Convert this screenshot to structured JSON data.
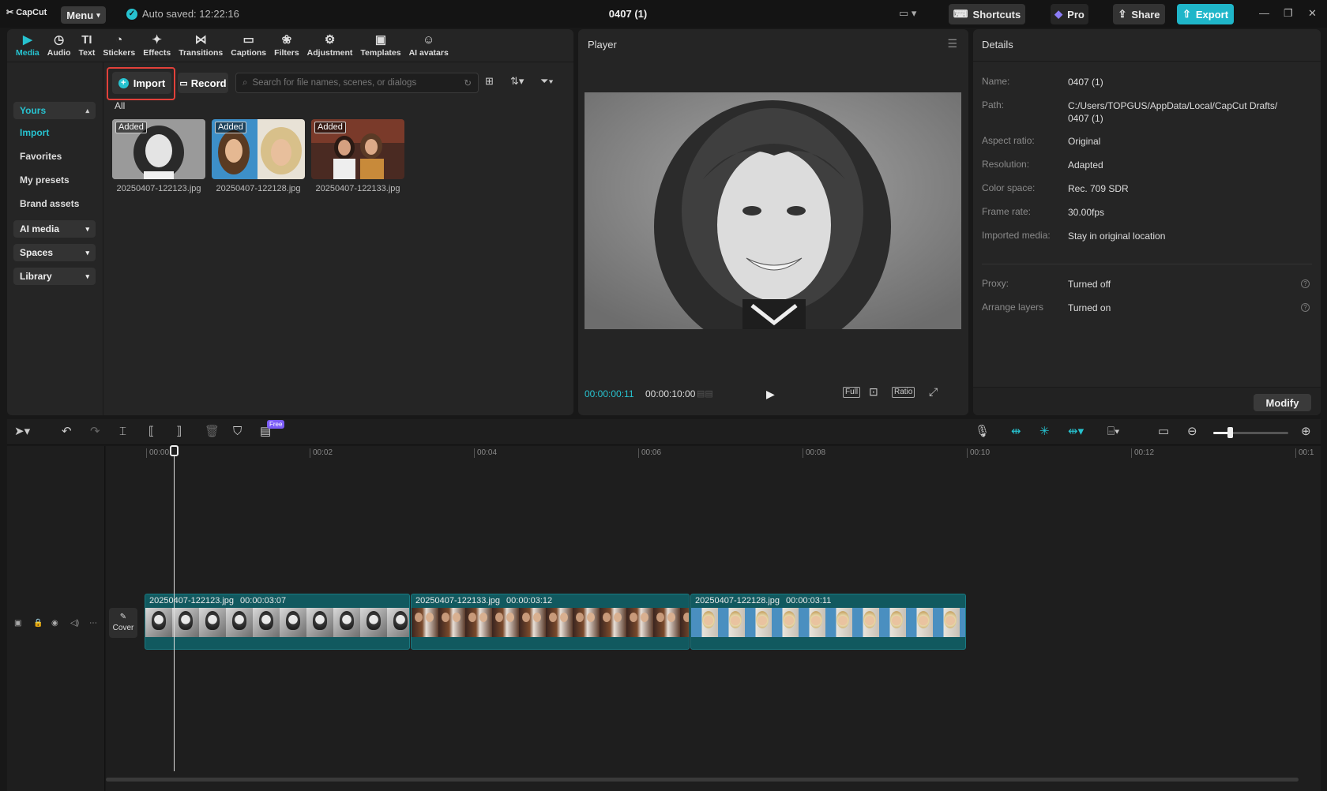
{
  "app": {
    "logo": "CapCut",
    "menu_label": "Menu",
    "autosave": "Auto saved: 12:22:16",
    "project_title": "0407 (1)",
    "shortcuts": "Shortcuts",
    "pro": "Pro",
    "share": "Share",
    "export": "Export",
    "accent_color": "#27c2cf",
    "highlight_color": "#e2413a"
  },
  "tabs": [
    {
      "label": "Media",
      "icon": "media-icon"
    },
    {
      "label": "Audio",
      "icon": "audio-icon"
    },
    {
      "label": "Text",
      "icon": "text-icon"
    },
    {
      "label": "Stickers",
      "icon": "stickers-icon"
    },
    {
      "label": "Effects",
      "icon": "effects-icon"
    },
    {
      "label": "Transitions",
      "icon": "transitions-icon"
    },
    {
      "label": "Captions",
      "icon": "captions-icon"
    },
    {
      "label": "Filters",
      "icon": "filters-icon"
    },
    {
      "label": "Adjustment",
      "icon": "adjustment-icon"
    },
    {
      "label": "Templates",
      "icon": "templates-icon"
    },
    {
      "label": "AI avatars",
      "icon": "ai-avatars-icon"
    }
  ],
  "sidebar": {
    "yours": "Yours",
    "items": [
      "Import",
      "Favorites",
      "My presets",
      "Brand assets"
    ],
    "groups": [
      "AI media",
      "Spaces",
      "Library"
    ]
  },
  "media": {
    "import": "Import",
    "record": "Record",
    "search_placeholder": "Search for file names, scenes, or dialogs",
    "filter_label": "All",
    "items": [
      {
        "badge": "Added",
        "name": "20250407-122123.jpg"
      },
      {
        "badge": "Added",
        "name": "20250407-122128.jpg"
      },
      {
        "badge": "Added",
        "name": "20250407-122133.jpg"
      }
    ]
  },
  "player": {
    "title": "Player",
    "current_time": "00:00:00:11",
    "total_time": "00:00:10:00",
    "full": "Full",
    "ratio": "Ratio"
  },
  "details": {
    "title": "Details",
    "rows": [
      {
        "key": "Name:",
        "value": "0407 (1)"
      },
      {
        "key": "Path:",
        "value": "C:/Users/TOPGUS/AppData/Local/CapCut Drafts/ 0407 (1)"
      },
      {
        "key": "Aspect ratio:",
        "value": "Original"
      },
      {
        "key": "Resolution:",
        "value": "Adapted"
      },
      {
        "key": "Color space:",
        "value": "Rec. 709 SDR"
      },
      {
        "key": "Frame rate:",
        "value": "30.00fps"
      },
      {
        "key": "Imported media:",
        "value": "Stay in original location"
      }
    ],
    "extra_rows": [
      {
        "key": "Proxy:",
        "value": "Turned off"
      },
      {
        "key": "Arrange layers",
        "value": "Turned on"
      }
    ],
    "modify": "Modify"
  },
  "timeline": {
    "free_badge": "Free",
    "ruler": [
      "00:00",
      "00:02",
      "00:04",
      "00:06",
      "00:08",
      "00:10",
      "00:12",
      "00:1"
    ],
    "cover_label": "Cover",
    "clips": [
      {
        "name": "20250407-122123.jpg",
        "duration": "00:00:03:07"
      },
      {
        "name": "20250407-122133.jpg",
        "duration": "00:00:03:12"
      },
      {
        "name": "20250407-122128.jpg",
        "duration": "00:00:03:11"
      }
    ]
  }
}
